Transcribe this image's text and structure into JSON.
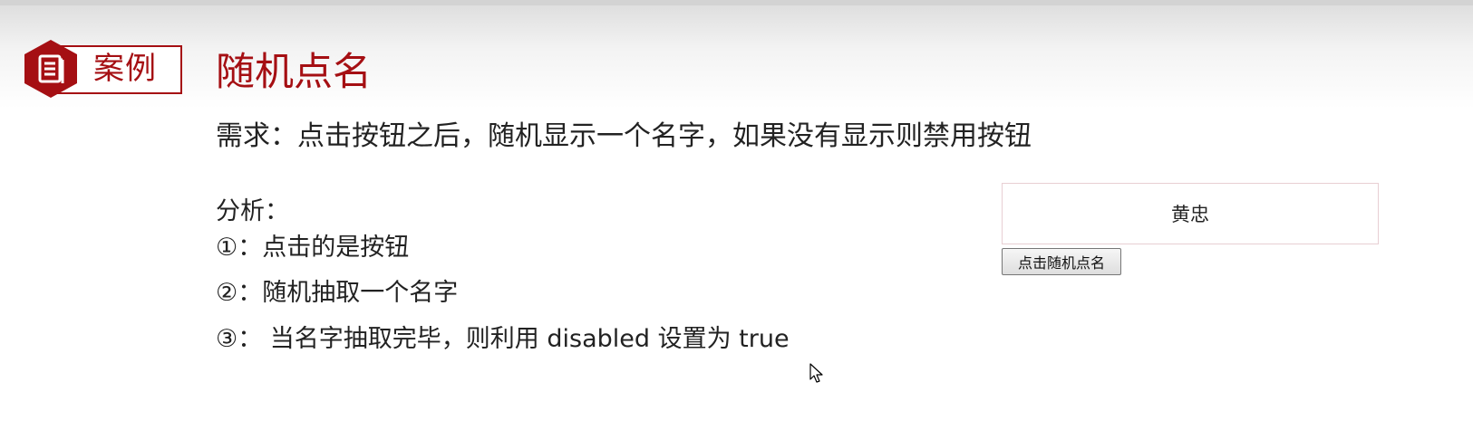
{
  "slide": {
    "badge_label": "案例",
    "title": "随机点名",
    "requirement": "需求：点击按钮之后，随机显示一个名字，如果没有显示则禁用按钮",
    "analysis": {
      "heading": "分析：",
      "steps": [
        "①：点击的是按钮",
        "②：随机抽取一个名字",
        "③： 当名字抽取完毕，则利用 disabled 设置为 true"
      ]
    }
  },
  "demo": {
    "name_display": "黄忠",
    "button_label": "点击随机点名"
  },
  "colors": {
    "accent": "#a50f13",
    "box_border": "#e8cfd3"
  },
  "icons": {
    "badge": "document-icon",
    "cursor": "mouse-pointer-icon"
  }
}
